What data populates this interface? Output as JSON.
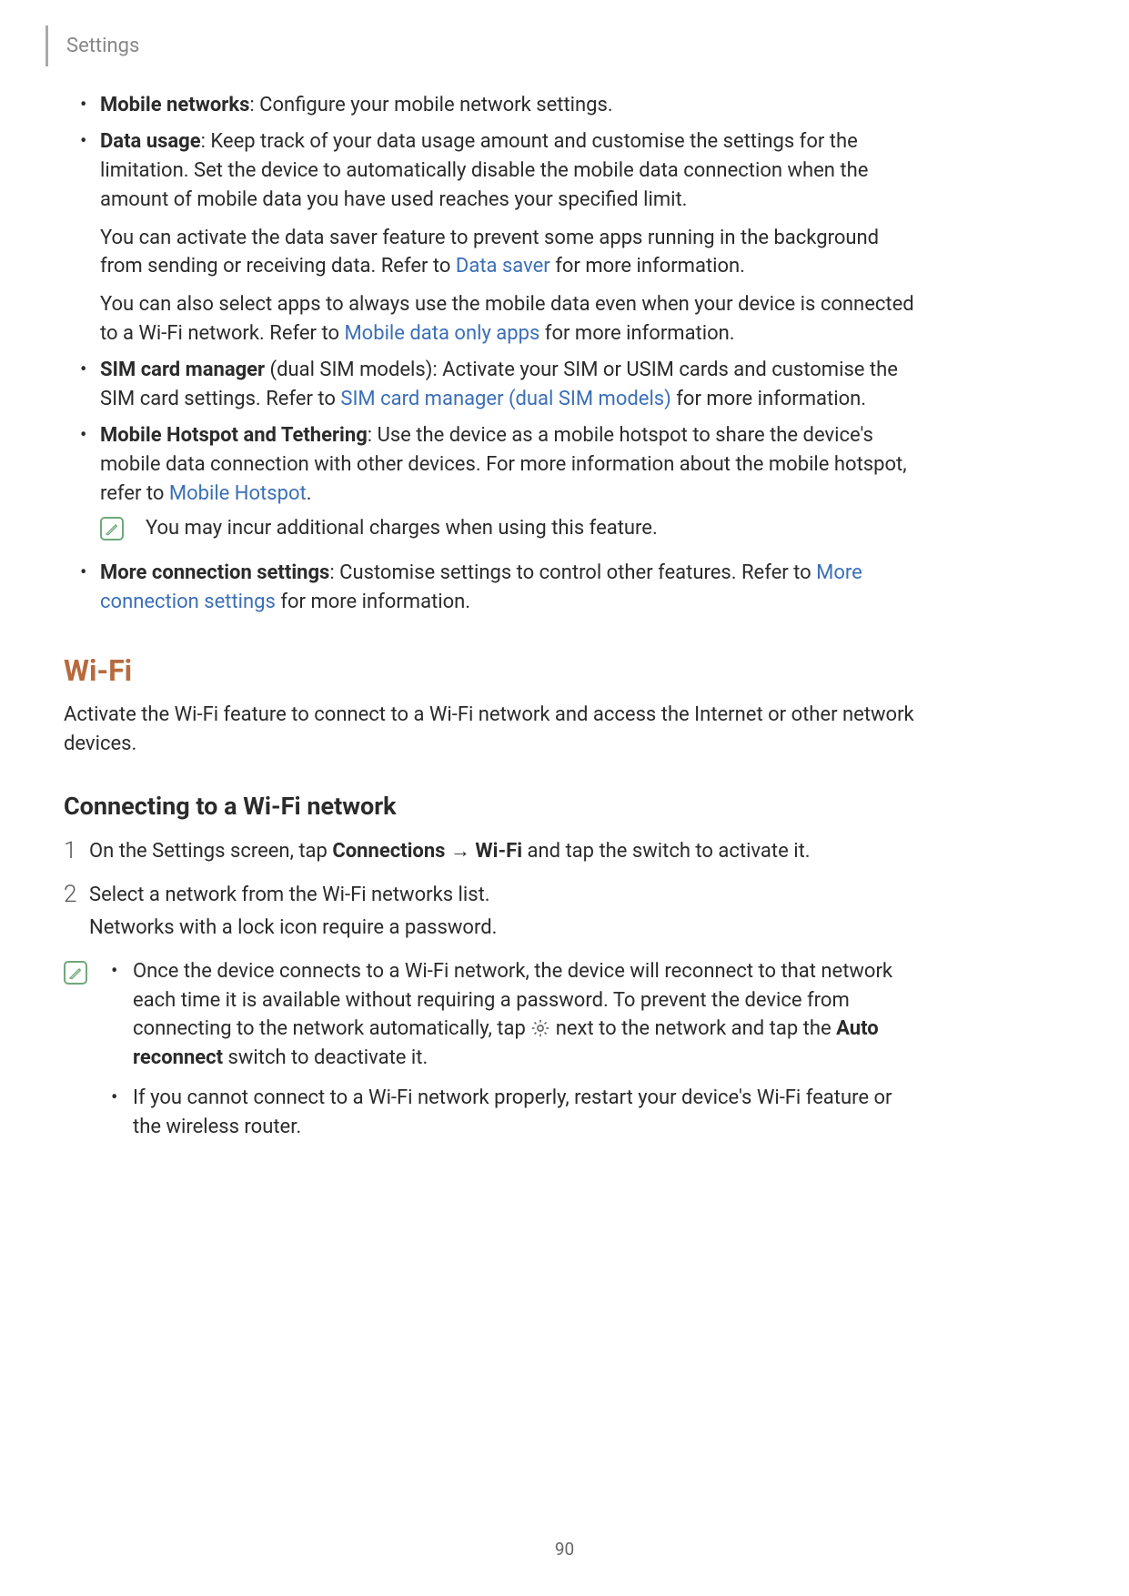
{
  "header": {
    "title": "Settings"
  },
  "bullets": {
    "mobile_networks": {
      "lead": "Mobile networks",
      "text": ": Configure your mobile network settings."
    },
    "data_usage": {
      "lead": "Data usage",
      "text1": ": Keep track of your data usage amount and customise the settings for the limitation. Set the device to automatically disable the mobile data connection when the amount of mobile data you have used reaches your specified limit.",
      "p2_a": "You can activate the data saver feature to prevent some apps running in the background from sending or receiving data. Refer to ",
      "p2_link": "Data saver",
      "p2_b": " for more information.",
      "p3_a": "You can also select apps to always use the mobile data even when your device is connected to a Wi-Fi network. Refer to ",
      "p3_link": "Mobile data only apps",
      "p3_b": " for more information."
    },
    "sim_card": {
      "lead": "SIM card manager",
      "text_a": " (dual SIM models): Activate your SIM or USIM cards and customise the SIM card settings. Refer to ",
      "link": "SIM card manager (dual SIM models)",
      "text_b": " for more information."
    },
    "hotspot": {
      "lead": "Mobile Hotspot and Tethering",
      "text_a": ": Use the device as a mobile hotspot to share the device's mobile data connection with other devices. For more information about the mobile hotspot, refer to ",
      "link": "Mobile Hotspot",
      "text_b": ".",
      "note": "You may incur additional charges when using this feature."
    },
    "more_conn": {
      "lead": "More connection settings",
      "text_a": ": Customise settings to control other features. Refer to ",
      "link": "More connection settings",
      "text_b": " for more information."
    }
  },
  "wifi": {
    "heading": "Wi-Fi",
    "intro": "Activate the Wi-Fi feature to connect to a Wi-Fi network and access the Internet or other network devices.",
    "sub_heading": "Connecting to a Wi-Fi network",
    "step1_num": "1",
    "step1_a": "On the Settings screen, tap ",
    "step1_b1": "Connections",
    "step1_arrow": " → ",
    "step1_b2": "Wi-Fi",
    "step1_c": " and tap the switch to activate it.",
    "step2_num": "2",
    "step2_a": "Select a network from the Wi-Fi networks list.",
    "step2_b": "Networks with a lock icon require a password.",
    "note1_a": "Once the device connects to a Wi-Fi network, the device will reconnect to that network each time it is available without requiring a password. To prevent the device from connecting to the network automatically, tap ",
    "note1_b": " next to the network and tap the ",
    "note1_bold": "Auto reconnect",
    "note1_c": " switch to deactivate it.",
    "note2": "If you cannot connect to a Wi-Fi network properly, restart your device's Wi-Fi feature or the wireless router."
  },
  "page_number": "90"
}
